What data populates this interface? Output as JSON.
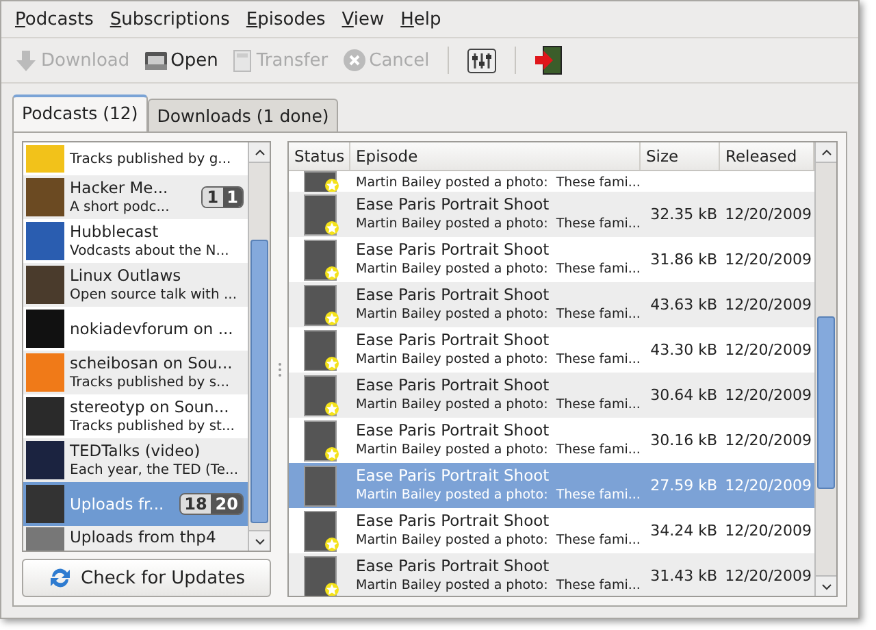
{
  "menu": [
    "Podcasts",
    "Subscriptions",
    "Episodes",
    "View",
    "Help"
  ],
  "toolbar": [
    {
      "kind": "download",
      "label": "Download",
      "disabled": true
    },
    {
      "kind": "open",
      "label": "Open",
      "disabled": false
    },
    {
      "kind": "transfer",
      "label": "Transfer",
      "disabled": true
    },
    {
      "kind": "cancel",
      "label": "Cancel",
      "disabled": true
    },
    {
      "kind": "separator"
    },
    {
      "kind": "preferences"
    },
    {
      "kind": "separator"
    },
    {
      "kind": "quit"
    }
  ],
  "tabs": [
    {
      "label": "Podcasts (12)",
      "selected": true
    },
    {
      "label": "Downloads (1 done)",
      "selected": false
    }
  ],
  "podcasts": [
    {
      "subtitle": "Tracks published by g...",
      "color": "#f2c21a",
      "selected": false
    },
    {
      "title": "Hacker Me...",
      "subtitle": "A short podc...",
      "color": "#6b4a22",
      "badge": [
        "1",
        "1"
      ],
      "selected": false
    },
    {
      "title": "Hubblecast",
      "subtitle": "Vodcasts about the N...",
      "color": "#2a5db0",
      "selected": false
    },
    {
      "title": "Linux Outlaws",
      "subtitle": "Open source talk with ...",
      "color": "#4a3b2c",
      "selected": false
    },
    {
      "title": "nokiadevforum on ...",
      "color": "#111111",
      "selected": false
    },
    {
      "title": "scheibosan on Sou...",
      "subtitle": "Tracks published by s...",
      "color": "#f07a18",
      "selected": false
    },
    {
      "title": "stereotyp on Soun...",
      "subtitle": "Tracks published by st...",
      "color": "#2a2a2a",
      "selected": false
    },
    {
      "title": "TEDTalks (video)",
      "subtitle": "Each year, the TED (Te...",
      "color": "#1b2340",
      "selected": false
    },
    {
      "title": "Uploads fr...",
      "color": "#333333",
      "badge": [
        "18",
        "20"
      ],
      "selected": true
    },
    {
      "title": "Uploads from thp4",
      "color": "#777777",
      "selected": false
    }
  ],
  "check_button": "Check for Updates",
  "columns": [
    "Status",
    "Episode",
    "Size",
    "Released"
  ],
  "episodes": [
    {
      "subtitle": "Martin Bailey posted a photo:  These fami...",
      "new": true,
      "selected": false
    },
    {
      "title": "Ease Paris Portrait Shoot",
      "subtitle": "Martin Bailey posted a photo:  These fami...",
      "size": "32.35 kB",
      "released": "12/20/2009",
      "new": true,
      "selected": false
    },
    {
      "title": "Ease Paris Portrait Shoot",
      "subtitle": "Martin Bailey posted a photo:  These fami...",
      "size": "31.86 kB",
      "released": "12/20/2009",
      "new": true,
      "selected": false
    },
    {
      "title": "Ease Paris Portrait Shoot",
      "subtitle": "Martin Bailey posted a photo:  These fami...",
      "size": "43.63 kB",
      "released": "12/20/2009",
      "new": true,
      "selected": false
    },
    {
      "title": "Ease Paris Portrait Shoot",
      "subtitle": "Martin Bailey posted a photo:  These fami...",
      "size": "43.30 kB",
      "released": "12/20/2009",
      "new": true,
      "selected": false
    },
    {
      "title": "Ease Paris Portrait Shoot",
      "subtitle": "Martin Bailey posted a photo:  These fami...",
      "size": "30.64 kB",
      "released": "12/20/2009",
      "new": true,
      "selected": false
    },
    {
      "title": "Ease Paris Portrait Shoot",
      "subtitle": "Martin Bailey posted a photo:  These fami...",
      "size": "30.16 kB",
      "released": "12/20/2009",
      "new": true,
      "selected": false
    },
    {
      "title": "Ease Paris Portrait Shoot",
      "subtitle": "Martin Bailey posted a photo:  These fami...",
      "size": "27.59 kB",
      "released": "12/20/2009",
      "new": false,
      "selected": true
    },
    {
      "title": "Ease Paris Portrait Shoot",
      "subtitle": "Martin Bailey posted a photo:  These fami...",
      "size": "34.24 kB",
      "released": "12/20/2009",
      "new": true,
      "selected": false
    },
    {
      "title": "Ease Paris Portrait Shoot",
      "subtitle": "Martin Bailey posted a photo:  These fami...",
      "size": "31.43 kB",
      "released": "12/20/2009",
      "new": true,
      "selected": false
    }
  ]
}
